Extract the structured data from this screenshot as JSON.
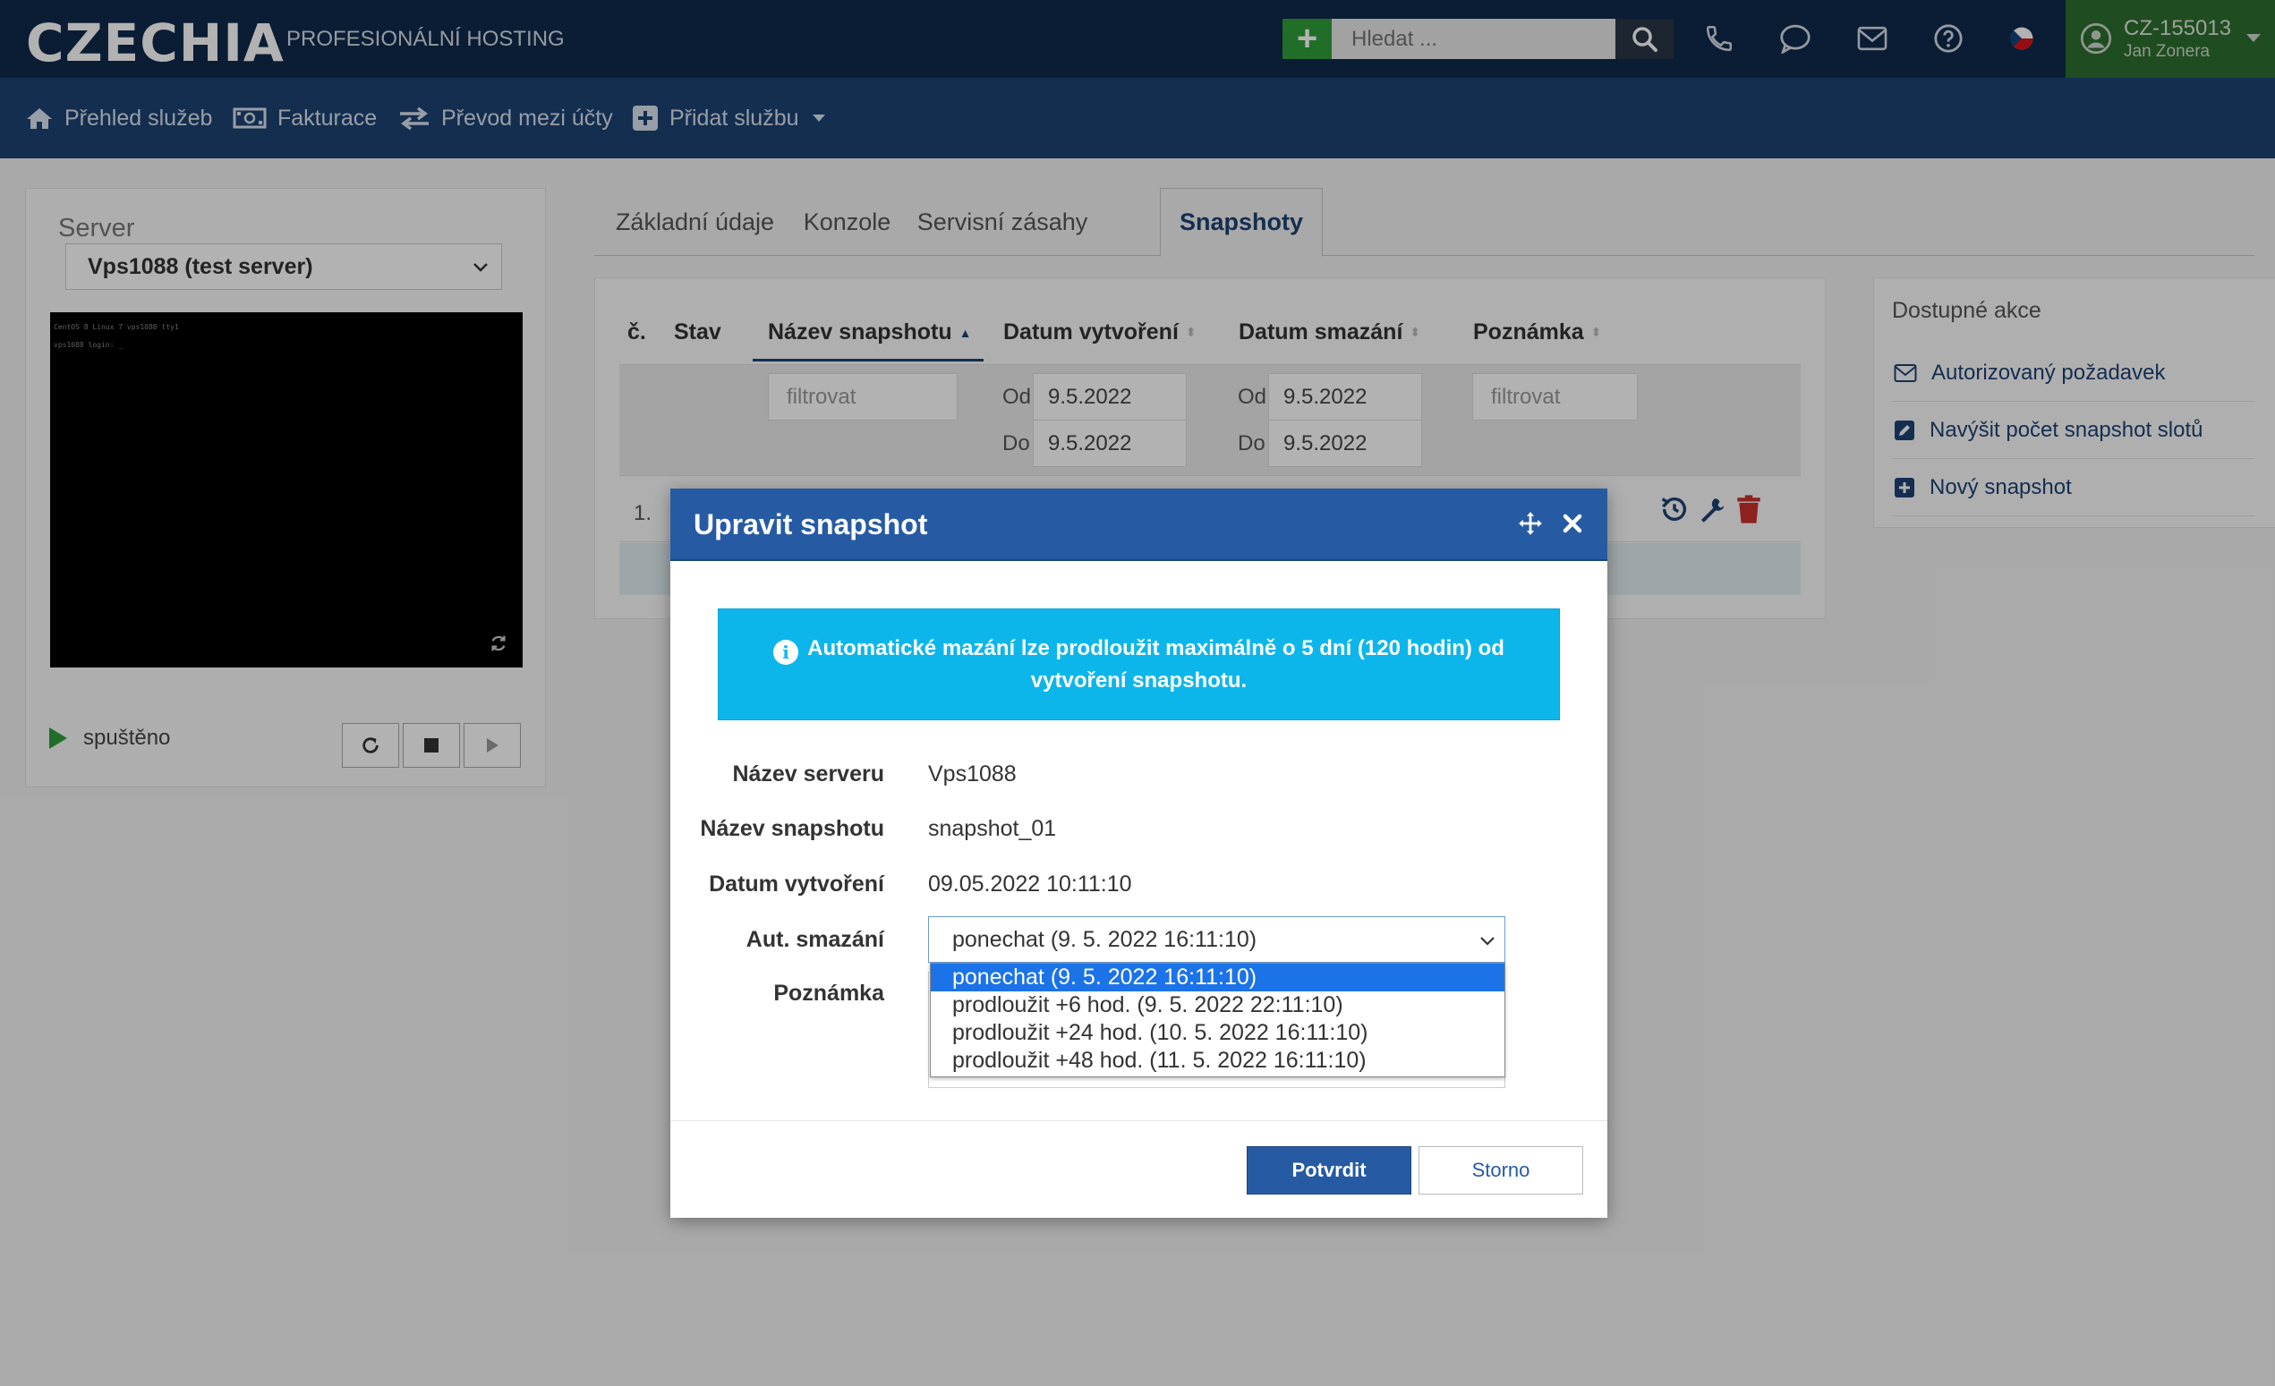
{
  "header": {
    "logo": "CZECHIA",
    "slogan": "PROFESIONÁLNÍ HOSTING",
    "add_label": "+",
    "search_placeholder": "Hledat ...",
    "user_id": "CZ-155013",
    "user_name": "Jan Zonera"
  },
  "nav": {
    "items": [
      {
        "label": "Přehled služeb",
        "icon": "home-icon"
      },
      {
        "label": "Fakturace",
        "icon": "money-icon"
      },
      {
        "label": "Převod mezi účty",
        "icon": "transfer-icon"
      },
      {
        "label": "Přidat službu",
        "icon": "plus-square-icon"
      }
    ]
  },
  "server_panel": {
    "label": "Server",
    "selected": "Vps1088 (test server)",
    "console_lines": [
      "CentOS 8 Linux 7 vps1088 tty1",
      "vps1088 login: _"
    ],
    "status": "spuštěno"
  },
  "tabs": [
    {
      "label": "Základní údaje",
      "active": false
    },
    {
      "label": "Konzole",
      "active": false
    },
    {
      "label": "Servisní zásahy",
      "active": false
    },
    {
      "label": "Snapshoty",
      "active": true
    }
  ],
  "table": {
    "headers": [
      "č.",
      "Stav",
      "Název snapshotu",
      "Datum vytvoření",
      "Datum smazání",
      "Poznámka"
    ],
    "filter_placeholder": "filtrovat",
    "od_label": "Od",
    "do_label": "Do",
    "created_from": "9.5.2022",
    "created_to": "9.5.2022",
    "deleted_from": "9.5.2022",
    "deleted_to": "9.5.2022",
    "rows": [
      {
        "num": "1."
      }
    ]
  },
  "actions": {
    "title": "Dostupné akce",
    "items": [
      {
        "label": "Autorizovaný požadavek",
        "icon": "envelope-icon"
      },
      {
        "label": "Navýšit počet snapshot slotů",
        "icon": "edit-icon"
      },
      {
        "label": "Nový snapshot",
        "icon": "plus-square-icon"
      }
    ]
  },
  "modal": {
    "title": "Upravit snapshot",
    "info": "Automatické mazání lze prodloužit maximálně o 5 dní (120 hodin) od vytvoření snapshotu.",
    "fields": {
      "server_label": "Název serveru",
      "server_value": "Vps1088",
      "snapshot_label": "Název snapshotu",
      "snapshot_value": "snapshot_01",
      "created_label": "Datum vytvoření",
      "created_value": "09.05.2022 10:11:10",
      "autodelete_label": "Aut. smazání",
      "autodelete_value": "ponechat (9. 5. 2022 16:11:10)",
      "note_label": "Poznámka"
    },
    "options": [
      "ponechat (9. 5. 2022 16:11:10)",
      "prodloužit +6 hod. (9. 5. 2022 22:11:10)",
      "prodloužit +24 hod. (10. 5. 2022 16:11:10)",
      "prodloužit +48 hod. (11. 5. 2022 16:11:10)"
    ],
    "confirm_label": "Potvrdit",
    "cancel_label": "Storno"
  },
  "colors": {
    "topbar": "#0f2a4b",
    "navbar": "#1e4273",
    "modal_header": "#265ba4",
    "info": "#0cb6eb",
    "user_box": "#2d6e2f",
    "add_button": "#2e9e3a"
  }
}
